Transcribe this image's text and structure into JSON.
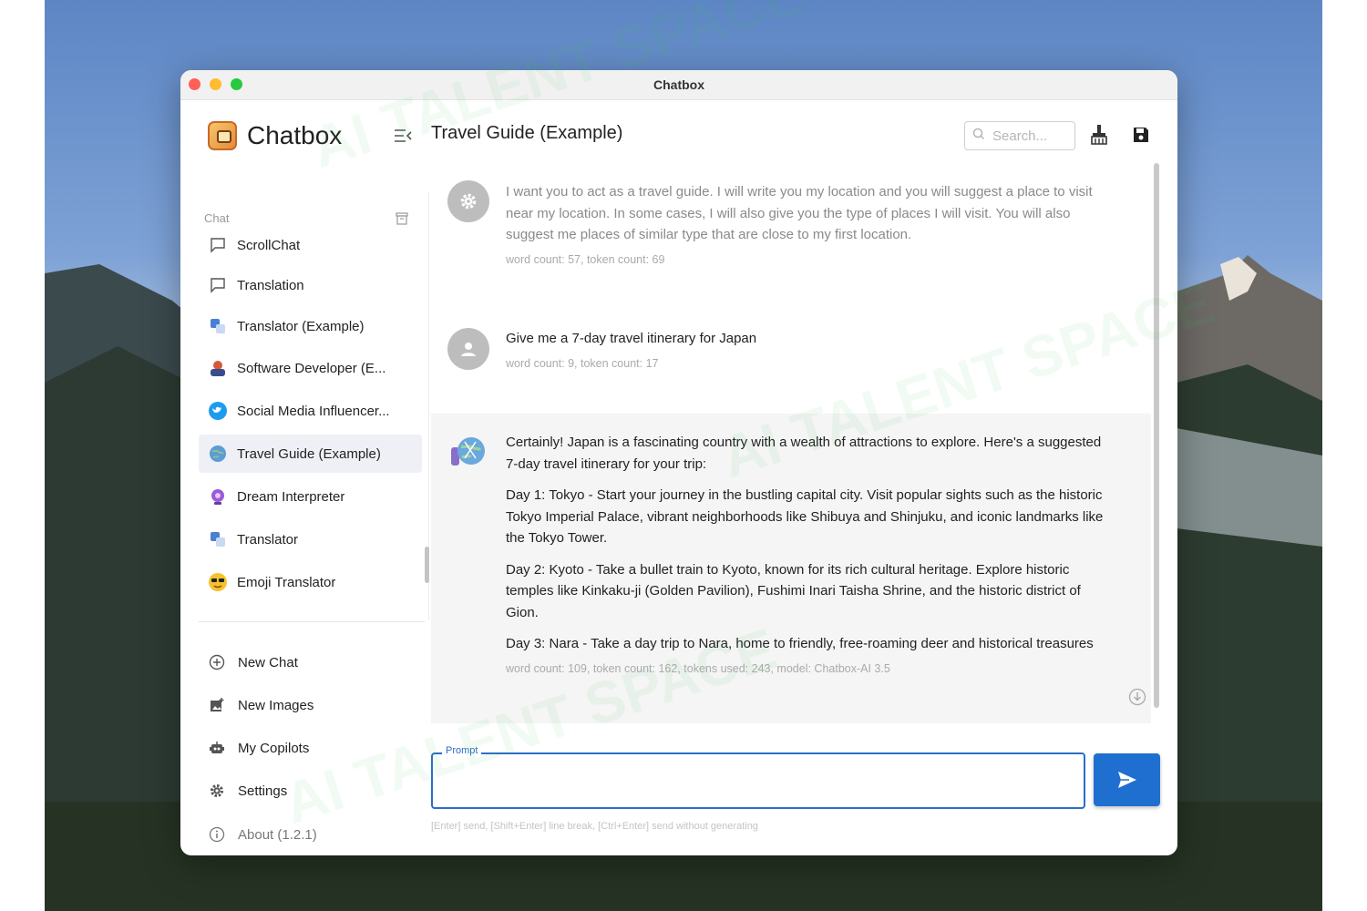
{
  "window": {
    "title": "Chatbox"
  },
  "sidebar": {
    "app_name": "Chatbox",
    "section_label": "Chat",
    "conversations": [
      {
        "label": "ScrollChat",
        "icon": "chat-bubble-icon"
      },
      {
        "label": "Translation",
        "icon": "chat-bubble-icon"
      },
      {
        "label": "Translator (Example)",
        "icon": "translator-avatar-icon"
      },
      {
        "label": "Software Developer (E...",
        "icon": "developer-avatar-icon"
      },
      {
        "label": "Social Media Influencer...",
        "icon": "twitter-avatar-icon"
      },
      {
        "label": "Travel Guide (Example)",
        "icon": "globe-avatar-icon"
      },
      {
        "label": "Dream Interpreter",
        "icon": "dream-avatar-icon"
      },
      {
        "label": "Translator",
        "icon": "translator-avatar-icon"
      },
      {
        "label": "Emoji Translator",
        "icon": "emoji-avatar-icon"
      }
    ],
    "active_index": 5,
    "nav": [
      {
        "label": "New Chat",
        "icon": "plus-circle-icon"
      },
      {
        "label": "New Images",
        "icon": "image-plus-icon"
      },
      {
        "label": "My Copilots",
        "icon": "robot-icon"
      },
      {
        "label": "Settings",
        "icon": "gear-icon"
      },
      {
        "label": "About (1.2.1)",
        "icon": "info-icon"
      }
    ]
  },
  "main": {
    "title": "Travel Guide (Example)",
    "search_placeholder": "Search...",
    "messages": [
      {
        "role": "system",
        "text": "I want you to act as a travel guide. I will write you my location and you will suggest a place to visit near my location. In some cases, I will also give you the type of places I will visit. You will also suggest me places of similar type that are close to my first location.",
        "meta": "word count: 57, token count: 69"
      },
      {
        "role": "user",
        "text": "Give me a 7-day travel itinerary for Japan",
        "meta": "word count: 9, token count: 17"
      },
      {
        "role": "assistant",
        "paragraphs": [
          "Certainly! Japan is a fascinating country with a wealth of attractions to explore. Here's a suggested 7-day travel itinerary for your trip:",
          "Day 1: Tokyo - Start your journey in the bustling capital city. Visit popular sights such as the historic Tokyo Imperial Palace, vibrant neighborhoods like Shibuya and Shinjuku, and iconic landmarks like the Tokyo Tower.",
          "Day 2: Kyoto - Take a bullet train to Kyoto, known for its rich cultural heritage. Explore historic temples like Kinkaku-ji (Golden Pavilion), Fushimi Inari Taisha Shrine, and the historic district of Gion.",
          "Day 3: Nara - Take a day trip to Nara, home to friendly, free-roaming deer and historical treasures"
        ],
        "meta": "word count: 109, token count: 162, tokens used: 243, model: Chatbox-AI 3.5"
      }
    ],
    "prompt_label": "Prompt",
    "prompt_value": "",
    "hint": "[Enter] send, [Shift+Enter] line break, [Ctrl+Enter] send without generating"
  },
  "watermark": "AI TALENT SPACE",
  "colors": {
    "accent": "#1f6fd1",
    "active_bg": "#eef0f5"
  }
}
